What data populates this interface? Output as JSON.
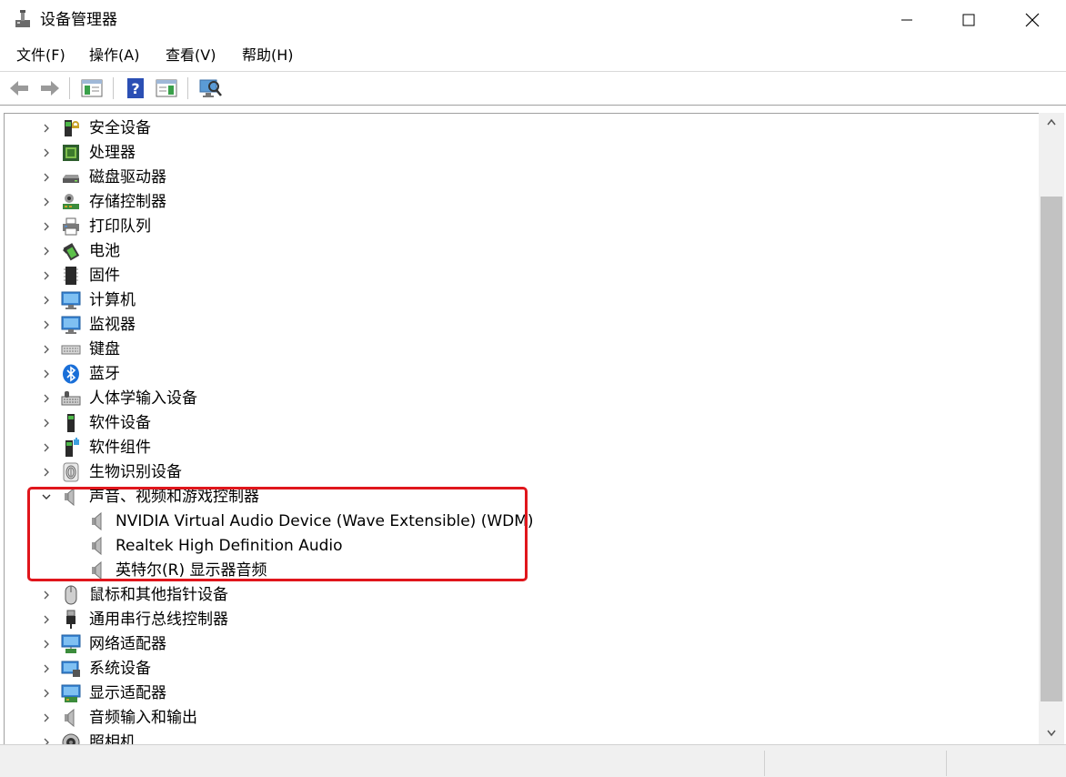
{
  "window": {
    "title": "设备管理器"
  },
  "menu": [
    "文件(F)",
    "操作(A)",
    "查看(V)",
    "帮助(H)"
  ],
  "tree": {
    "before": [
      {
        "label": "安全设备",
        "icon": "security-key-icon"
      },
      {
        "label": "处理器",
        "icon": "processor-chip-icon"
      },
      {
        "label": "磁盘驱动器",
        "icon": "disk-drive-icon"
      },
      {
        "label": "存储控制器",
        "icon": "storage-controller-icon"
      },
      {
        "label": "打印队列",
        "icon": "printer-icon"
      },
      {
        "label": "电池",
        "icon": "battery-icon"
      },
      {
        "label": "固件",
        "icon": "firmware-chip-icon"
      },
      {
        "label": "计算机",
        "icon": "computer-monitor-icon"
      },
      {
        "label": "监视器",
        "icon": "monitor-icon"
      },
      {
        "label": "键盘",
        "icon": "keyboard-icon"
      },
      {
        "label": "蓝牙",
        "icon": "bluetooth-icon"
      },
      {
        "label": "人体学输入设备",
        "icon": "hid-device-icon"
      },
      {
        "label": "软件设备",
        "icon": "software-device-icon"
      },
      {
        "label": "软件组件",
        "icon": "software-component-icon"
      },
      {
        "label": "生物识别设备",
        "icon": "fingerprint-icon"
      }
    ],
    "expanded": {
      "label": "声音、视频和游戏控制器",
      "children": [
        "NVIDIA Virtual Audio Device (Wave Extensible) (WDM)",
        "Realtek High Definition Audio",
        "英特尔(R) 显示器音频"
      ]
    },
    "after": [
      {
        "label": "鼠标和其他指针设备",
        "icon": "mouse-icon"
      },
      {
        "label": "通用串行总线控制器",
        "icon": "usb-icon"
      },
      {
        "label": "网络适配器",
        "icon": "network-adapter-icon"
      },
      {
        "label": "系统设备",
        "icon": "system-device-icon"
      },
      {
        "label": "显示适配器",
        "icon": "display-adapter-icon"
      },
      {
        "label": "音频输入和输出",
        "icon": "speaker-icon"
      },
      {
        "label": "照相机",
        "icon": "camera-icon"
      }
    ]
  },
  "colors": {
    "highlight": "#e0161c",
    "scroll_thumb": "#c2c2c2"
  }
}
